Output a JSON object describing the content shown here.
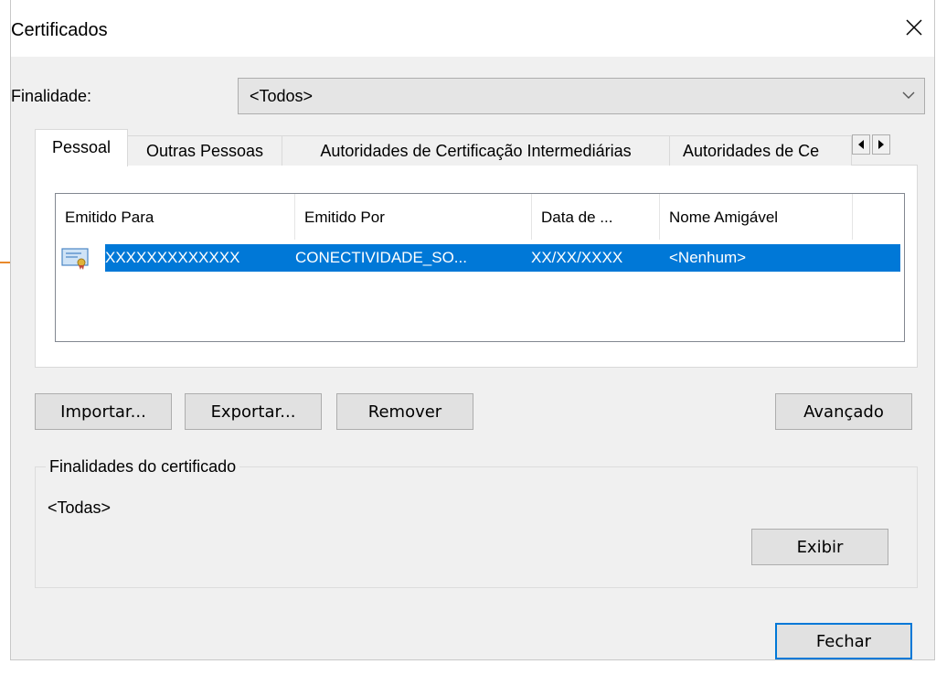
{
  "window": {
    "title": "Certificados"
  },
  "purpose": {
    "label": "Finalidade:",
    "value": "<Todos>"
  },
  "tabs": [
    {
      "label": "Pessoal"
    },
    {
      "label": "Outras Pessoas"
    },
    {
      "label": "Autoridades de Certificação Intermediárias"
    },
    {
      "label": "Autoridades de Ce"
    }
  ],
  "list": {
    "columns": [
      "Emitido Para",
      "Emitido Por",
      "Data de ...",
      "Nome Amigável"
    ],
    "rows": [
      {
        "issued_to": "XXXXXXXXXXXXX",
        "issued_by": "CONECTIVIDADE_SO...",
        "expiry": "XX/XX/XXXX",
        "friendly_name": "<Nenhum>"
      }
    ]
  },
  "buttons": {
    "import": "Importar...",
    "export": "Exportar...",
    "remove": "Remover",
    "advanced": "Avançado",
    "view": "Exibir",
    "close": "Fechar"
  },
  "cert_purposes": {
    "title": "Finalidades do certificado",
    "value": "<Todas>"
  },
  "colors": {
    "selection": "#0078d7",
    "accent_line": "#e8892b"
  }
}
